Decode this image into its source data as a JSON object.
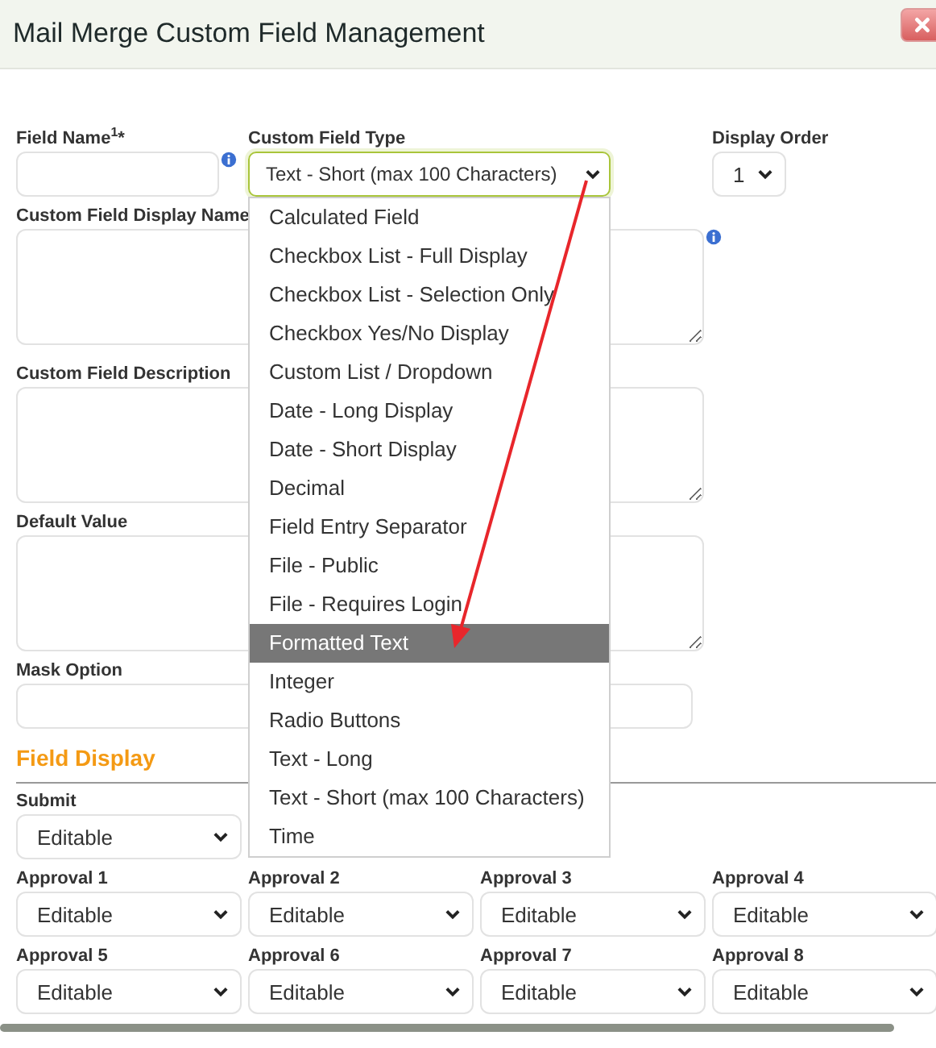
{
  "window": {
    "title": "Mail Merge Custom Field Management"
  },
  "fields": {
    "field_name": {
      "label": "Field Name$^{1}$*"
    },
    "custom_field_type": {
      "label": "Custom Field Type",
      "value": "Text - Short (max 100 Characters)",
      "expanded": true,
      "options": [
        {
          "label": "Calculated Field",
          "highlighted": false
        },
        {
          "label": "Checkbox List - Full Display",
          "highlighted": false
        },
        {
          "label": "Checkbox List - Selection Only",
          "highlighted": false
        },
        {
          "label": "Checkbox Yes/No Display",
          "highlighted": false
        },
        {
          "label": "Custom List / Dropdown",
          "highlighted": false
        },
        {
          "label": "Date - Long Display",
          "highlighted": false
        },
        {
          "label": "Date - Short Display",
          "highlighted": false
        },
        {
          "label": "Decimal",
          "highlighted": false
        },
        {
          "label": "Field Entry Separator",
          "highlighted": false
        },
        {
          "label": "File - Public",
          "highlighted": false
        },
        {
          "label": "File - Requires Login",
          "highlighted": false
        },
        {
          "label": "Formatted Text",
          "highlighted": true
        },
        {
          "label": "Integer",
          "highlighted": false
        },
        {
          "label": "Radio Buttons",
          "highlighted": false
        },
        {
          "label": "Text - Long",
          "highlighted": false
        },
        {
          "label": "Text - Short (max 100 Characters)",
          "highlighted": false
        },
        {
          "label": "Time",
          "highlighted": false
        }
      ]
    },
    "display_order": {
      "label": "Display Order",
      "value": "1"
    },
    "display_name": {
      "label": "Custom Field Display Name"
    },
    "description": {
      "label": "Custom Field Description"
    },
    "default_value": {
      "label": "Default Value"
    },
    "mask_option": {
      "label": "Mask Option"
    }
  },
  "field_display": {
    "heading": "Field Display",
    "selects": [
      {
        "label": "Submit",
        "value": "Editable"
      },
      {
        "label": "Approval 1",
        "value": "Editable"
      },
      {
        "label": "Approval 2",
        "value": "Editable"
      },
      {
        "label": "Approval 3",
        "value": "Editable"
      },
      {
        "label": "Approval 4",
        "value": "Editable"
      },
      {
        "label": "Approval 5",
        "value": "Editable"
      },
      {
        "label": "Approval 6",
        "value": "Editable"
      },
      {
        "label": "Approval 7",
        "value": "Editable"
      },
      {
        "label": "Approval 8",
        "value": "Editable"
      }
    ]
  }
}
